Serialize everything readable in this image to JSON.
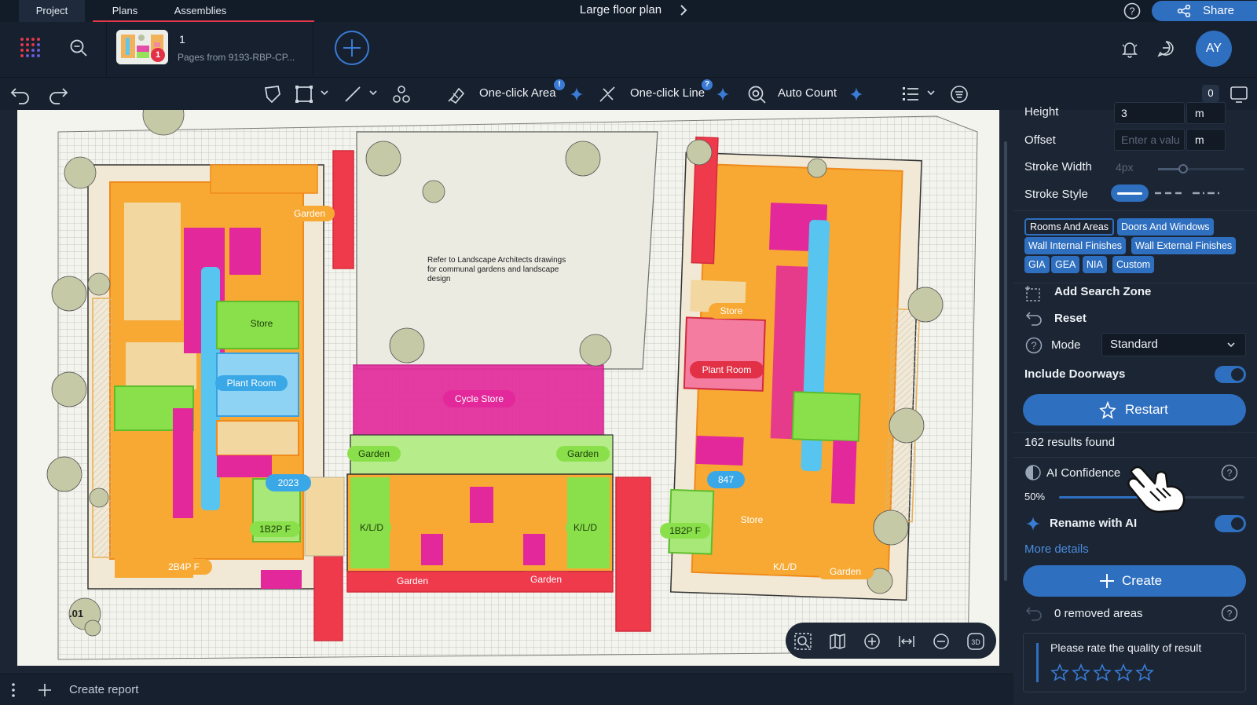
{
  "tabs": {
    "project": "Project",
    "plans": "Plans",
    "assemblies": "Assemblies"
  },
  "header": {
    "title": "Large floor plan",
    "share_label": "Share",
    "avatar_initials": "AY"
  },
  "document": {
    "number": "1",
    "subtitle": "Pages from 9193-RBP-CP...",
    "badge": "1"
  },
  "toolbar": {
    "one_click_area": "One-click Area",
    "one_click_line": "One-click Line",
    "auto_count": "Auto Count",
    "area_badge": "!",
    "line_badge": "?",
    "count_zero": "0"
  },
  "plan": {
    "note": [
      "Refer to Landscape Architects drawings",
      "for communal gardens and landscape",
      "design"
    ],
    "labels": {
      "garden_top": "Garden",
      "store_left": "Store",
      "plant_left": "Plant Room",
      "cycle_store": "Cycle Store",
      "garden_mid_left": "Garden",
      "garden_mid_right": "Garden",
      "count_2023": "2023",
      "b2p_left": "1B2P F",
      "b4p_left": "2B4P F",
      "klad_1": "K/L/D",
      "klad_2": "K/L/D",
      "garden_bot_1": "Garden",
      "garden_bot_2": "Garden",
      "store_right_top": "Store",
      "plant_right": "Plant Room",
      "count_847": "847",
      "b2p_right": "1B2P F",
      "store_right_bot": "Store",
      "klad_right": "K/L/D",
      "garden_right": "Garden",
      "sheet_id": ".01"
    }
  },
  "panel": {
    "height_label": "Height",
    "height_value": "3",
    "height_unit": "m",
    "offset_label": "Offset",
    "offset_placeholder": "Enter a valu",
    "offset_unit": "m",
    "stroke_width_label": "Stroke Width",
    "stroke_width_value": "4px",
    "stroke_style_label": "Stroke Style",
    "chips": [
      "Rooms And Areas",
      "Doors And Windows",
      "Wall Internal Finishes",
      "Wall External Finishes",
      "GIA",
      "GEA",
      "NIA",
      "Custom"
    ],
    "add_search_zone": "Add Search Zone",
    "reset": "Reset",
    "mode_label": "Mode",
    "mode_value": "Standard",
    "include_doorways": "Include Doorways",
    "restart": "Restart",
    "results": "162 results found",
    "ai_confidence": "AI Confidence",
    "confidence_value": "50%",
    "rename_ai": "Rename with AI",
    "more_details": "More details",
    "create": "Create",
    "removed": "0 removed areas",
    "rate_prompt": "Please rate the quality of result",
    "rating": 0
  },
  "bottom": {
    "create_report": "Create report"
  },
  "colors": {
    "accent": "#2f6fc0",
    "tab_underline": "#e2384a",
    "area_orange": "#f7a934",
    "area_pink": "#e2289a",
    "area_blue": "#58c4f0",
    "area_green": "#8ae04a",
    "area_red": "#ef3a4c"
  }
}
